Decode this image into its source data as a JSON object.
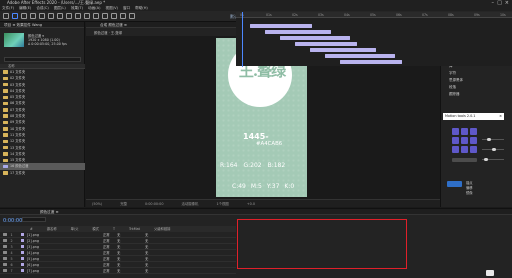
{
  "app": {
    "title": "Adobe After Effects 2020 - /Users/.../王.聱绿.aep *",
    "menu": [
      "文件(F)",
      "编辑(E)",
      "合成(C)",
      "图层(L)",
      "效果(T)",
      "动画(A)",
      "视图(V)",
      "窗口",
      "帮助(H)"
    ],
    "workspaces": [
      "默认",
      "学习",
      "标准",
      "小屏幕",
      "库"
    ],
    "search_placeholder": "搜索帮助"
  },
  "project": {
    "tab": "项目 ≡   效果控件 Wang",
    "info": [
      "颜色过渡 ▾",
      "1920 x 1080 (1.00)",
      "Δ 0:00:05:00, 25.00 fps"
    ],
    "column_header": "名称",
    "items": [
      {
        "label": "01 文件夹",
        "type": "folder"
      },
      {
        "label": "02 文件夹",
        "type": "folder"
      },
      {
        "label": "03 文件夹",
        "type": "folder"
      },
      {
        "label": "04 文件夹",
        "type": "folder"
      },
      {
        "label": "05 文件夹",
        "type": "folder"
      },
      {
        "label": "06 文件夹",
        "type": "folder"
      },
      {
        "label": "07 文件夹",
        "type": "folder"
      },
      {
        "label": "08 文件夹",
        "type": "folder"
      },
      {
        "label": "09 文件夹",
        "type": "folder"
      },
      {
        "label": "10 文件夹",
        "type": "folder"
      },
      {
        "label": "11 文件夹",
        "type": "folder"
      },
      {
        "label": "12 文件夹",
        "type": "folder"
      },
      {
        "label": "13 文件夹",
        "type": "folder"
      },
      {
        "label": "14 文件夹",
        "type": "folder"
      },
      {
        "label": "15 文件夹",
        "type": "folder"
      },
      {
        "label": "16 颜色过渡",
        "type": "comp",
        "selected": true
      },
      {
        "label": "17 文件夹",
        "type": "folder"
      }
    ]
  },
  "composition": {
    "tab": "合成 颜色过渡 ≡",
    "sub_label": "颜色过渡 · 王.聱绿",
    "card": {
      "logo_text": "王.聱绿",
      "number": "1445-",
      "hex": "#A4CAB6",
      "rgb": [
        "R:164",
        "G:202",
        "B:182"
      ],
      "cmyk": [
        "C:49",
        "M:5",
        "Y:37",
        "K:0"
      ],
      "bg_color": "#a4cab6"
    },
    "footer": [
      "(50%)",
      "完整",
      "0:00:00:00",
      "活动摄像机",
      "1个视图",
      "+0.0"
    ]
  },
  "right_panel": {
    "title": "信息  ≡  音频",
    "rows": [
      "信息",
      "音频",
      "预览",
      "效果和预设",
      "对齐",
      "库",
      "字符",
      "段落",
      "跟踪器"
    ],
    "char_font": "思源黑体",
    "motion_title": "Motion tools 2.0.1",
    "tools": [
      "锚点",
      "偏移",
      "镜像",
      "蒙版",
      "拆分"
    ]
  },
  "timeline": {
    "tab": "颜色过渡  ≡",
    "timecode": "0:00:00:00",
    "header": [
      "#",
      "源名称",
      "单/父",
      "模式",
      "T",
      "TrkMat",
      "父级和链接"
    ],
    "layers": [
      {
        "num": "1",
        "name": "[1].png",
        "mode": "正常",
        "trkmat": "无",
        "parent": "无"
      },
      {
        "num": "2",
        "name": "[2].png",
        "mode": "正常",
        "trkmat": "无",
        "parent": "无"
      },
      {
        "num": "3",
        "name": "[3].png",
        "mode": "正常",
        "trkmat": "无",
        "parent": "无"
      },
      {
        "num": "4",
        "name": "[4].png",
        "mode": "正常",
        "trkmat": "无",
        "parent": "无"
      },
      {
        "num": "5",
        "name": "[5].png",
        "mode": "正常",
        "trkmat": "无",
        "parent": "无"
      },
      {
        "num": "6",
        "name": "[6].png",
        "mode": "正常",
        "trkmat": "无",
        "parent": "无"
      },
      {
        "num": "7",
        "name": "[7].png",
        "mode": "正常",
        "trkmat": "无",
        "parent": "无"
      }
    ],
    "ruler_ticks": [
      "0s",
      "01s",
      "02s",
      "03s",
      "04s",
      "05s",
      "06s",
      "07s",
      "08s",
      "09s",
      "10s"
    ]
  }
}
